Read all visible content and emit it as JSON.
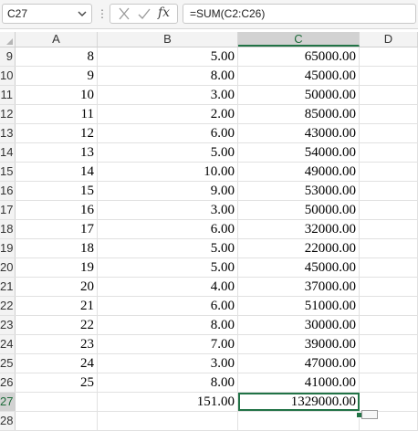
{
  "formula_bar": {
    "name_box": "C27",
    "name_box_icon": "chevron-down-icon",
    "separator_icon": "vertical-ellipsis-icon",
    "cancel_icon": "cancel-x-icon",
    "enter_icon": "checkmark-icon",
    "fx_label": "fx",
    "formula": "=SUM(C2:C26)"
  },
  "columns": [
    "A",
    "B",
    "C",
    "D"
  ],
  "selected_column": "C",
  "rows": [
    {
      "row": "9",
      "a": "8",
      "b": "5.00",
      "c": "65000.00"
    },
    {
      "row": "10",
      "a": "9",
      "b": "8.00",
      "c": "45000.00"
    },
    {
      "row": "11",
      "a": "10",
      "b": "3.00",
      "c": "50000.00"
    },
    {
      "row": "12",
      "a": "11",
      "b": "2.00",
      "c": "85000.00"
    },
    {
      "row": "13",
      "a": "12",
      "b": "6.00",
      "c": "43000.00"
    },
    {
      "row": "14",
      "a": "13",
      "b": "5.00",
      "c": "54000.00"
    },
    {
      "row": "15",
      "a": "14",
      "b": "10.00",
      "c": "49000.00"
    },
    {
      "row": "16",
      "a": "15",
      "b": "9.00",
      "c": "53000.00"
    },
    {
      "row": "17",
      "a": "16",
      "b": "3.00",
      "c": "50000.00"
    },
    {
      "row": "18",
      "a": "17",
      "b": "6.00",
      "c": "32000.00"
    },
    {
      "row": "19",
      "a": "18",
      "b": "5.00",
      "c": "22000.00"
    },
    {
      "row": "20",
      "a": "19",
      "b": "5.00",
      "c": "45000.00"
    },
    {
      "row": "21",
      "a": "20",
      "b": "4.00",
      "c": "37000.00"
    },
    {
      "row": "22",
      "a": "21",
      "b": "6.00",
      "c": "51000.00"
    },
    {
      "row": "23",
      "a": "22",
      "b": "8.00",
      "c": "30000.00"
    },
    {
      "row": "24",
      "a": "23",
      "b": "7.00",
      "c": "39000.00"
    },
    {
      "row": "25",
      "a": "24",
      "b": "3.00",
      "c": "47000.00"
    },
    {
      "row": "26",
      "a": "25",
      "b": "8.00",
      "c": "41000.00"
    },
    {
      "row": "27",
      "a": "",
      "b": "151.00",
      "c": "1329000.00",
      "active": true
    },
    {
      "row": "28",
      "a": "",
      "b": "",
      "c": ""
    }
  ],
  "colors": {
    "accent": "#217346",
    "header_bg": "#f3f3f3",
    "header_selected_bg": "#d2d2d2",
    "gridline": "#e1e1e1"
  }
}
